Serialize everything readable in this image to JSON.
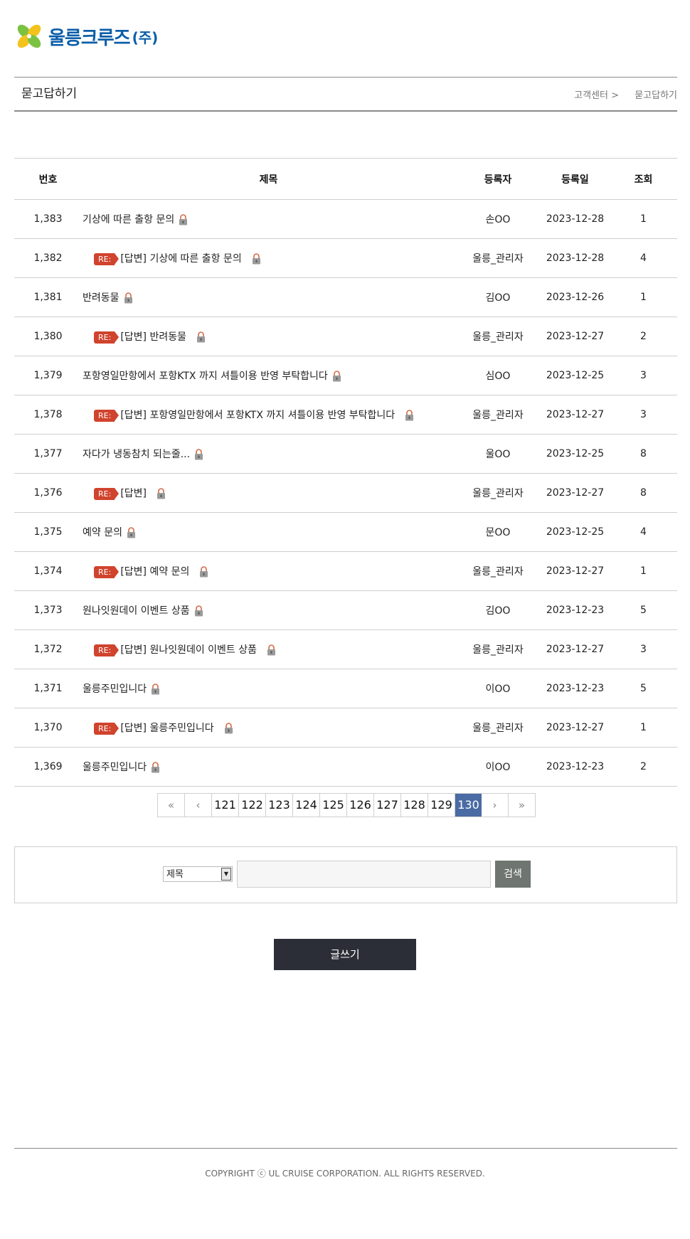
{
  "logo": {
    "text": "울릉크루즈",
    "sub": "(주)"
  },
  "page_title": "묻고답하기",
  "breadcrumb": {
    "item1": "고객센터 >",
    "item2": "묻고답하기"
  },
  "table": {
    "headers": {
      "num": "번호",
      "subject": "제목",
      "writer": "등록자",
      "date": "등록일",
      "hits": "조회"
    },
    "re_label": "RE:",
    "rows": [
      {
        "num": "1,383",
        "subject": "기상에 따른 출항 문의",
        "writer": "손OO",
        "date": "2023-12-28",
        "hits": "1",
        "reply": false
      },
      {
        "num": "1,382",
        "subject": "[답변] 기상에 따른 출항 문의",
        "writer": "울릉_관리자",
        "date": "2023-12-28",
        "hits": "4",
        "reply": true
      },
      {
        "num": "1,381",
        "subject": "반려동물",
        "writer": "김OO",
        "date": "2023-12-26",
        "hits": "1",
        "reply": false
      },
      {
        "num": "1,380",
        "subject": "[답변] 반려동물",
        "writer": "울릉_관리자",
        "date": "2023-12-27",
        "hits": "2",
        "reply": true
      },
      {
        "num": "1,379",
        "subject": "포항영일만항에서 포항KTX 까지 셔틀이용 반영 부탁합니다",
        "writer": "심OO",
        "date": "2023-12-25",
        "hits": "3",
        "reply": false
      },
      {
        "num": "1,378",
        "subject": "[답변] 포항영일만항에서 포항KTX 까지 셔틀이용 반영 부탁합니다",
        "writer": "울릉_관리자",
        "date": "2023-12-27",
        "hits": "3",
        "reply": true
      },
      {
        "num": "1,377",
        "subject": "자다가 냉동참치 되는줄...",
        "writer": "울OO",
        "date": "2023-12-25",
        "hits": "8",
        "reply": false
      },
      {
        "num": "1,376",
        "subject": "[답변]",
        "writer": "울릉_관리자",
        "date": "2023-12-27",
        "hits": "8",
        "reply": true
      },
      {
        "num": "1,375",
        "subject": "예약 문의",
        "writer": "문OO",
        "date": "2023-12-25",
        "hits": "4",
        "reply": false
      },
      {
        "num": "1,374",
        "subject": "[답변] 예약 문의",
        "writer": "울릉_관리자",
        "date": "2023-12-27",
        "hits": "1",
        "reply": true
      },
      {
        "num": "1,373",
        "subject": "원나잇원데이 이벤트 상품",
        "writer": "김OO",
        "date": "2023-12-23",
        "hits": "5",
        "reply": false
      },
      {
        "num": "1,372",
        "subject": "[답변] 원나잇원데이 이벤트 상품",
        "writer": "울릉_관리자",
        "date": "2023-12-27",
        "hits": "3",
        "reply": true
      },
      {
        "num": "1,371",
        "subject": "울릉주민입니다",
        "writer": "이OO",
        "date": "2023-12-23",
        "hits": "5",
        "reply": false
      },
      {
        "num": "1,370",
        "subject": "[답변] 울릉주민입니다",
        "writer": "울릉_관리자",
        "date": "2023-12-27",
        "hits": "1",
        "reply": true
      },
      {
        "num": "1,369",
        "subject": "울릉주민입니다",
        "writer": "이OO",
        "date": "2023-12-23",
        "hits": "2",
        "reply": false
      }
    ]
  },
  "pagination": {
    "first": "«",
    "prev": "‹",
    "next": "›",
    "last": "»",
    "pages": [
      "121",
      "122",
      "123",
      "124",
      "125",
      "126",
      "127",
      "128",
      "129",
      "130"
    ],
    "current": "130"
  },
  "search": {
    "field": "제목",
    "button": "검색"
  },
  "write_button": "글쓰기",
  "copyright": "COPYRIGHT ⓒ UL CRUISE CORPORATION. ALL RIGHTS RESERVED.",
  "colors": {
    "brand": "#0b5ea8",
    "re_badge": "#d0432d",
    "page_active": "#4a6ba3",
    "write_button": "#2c2e37"
  }
}
